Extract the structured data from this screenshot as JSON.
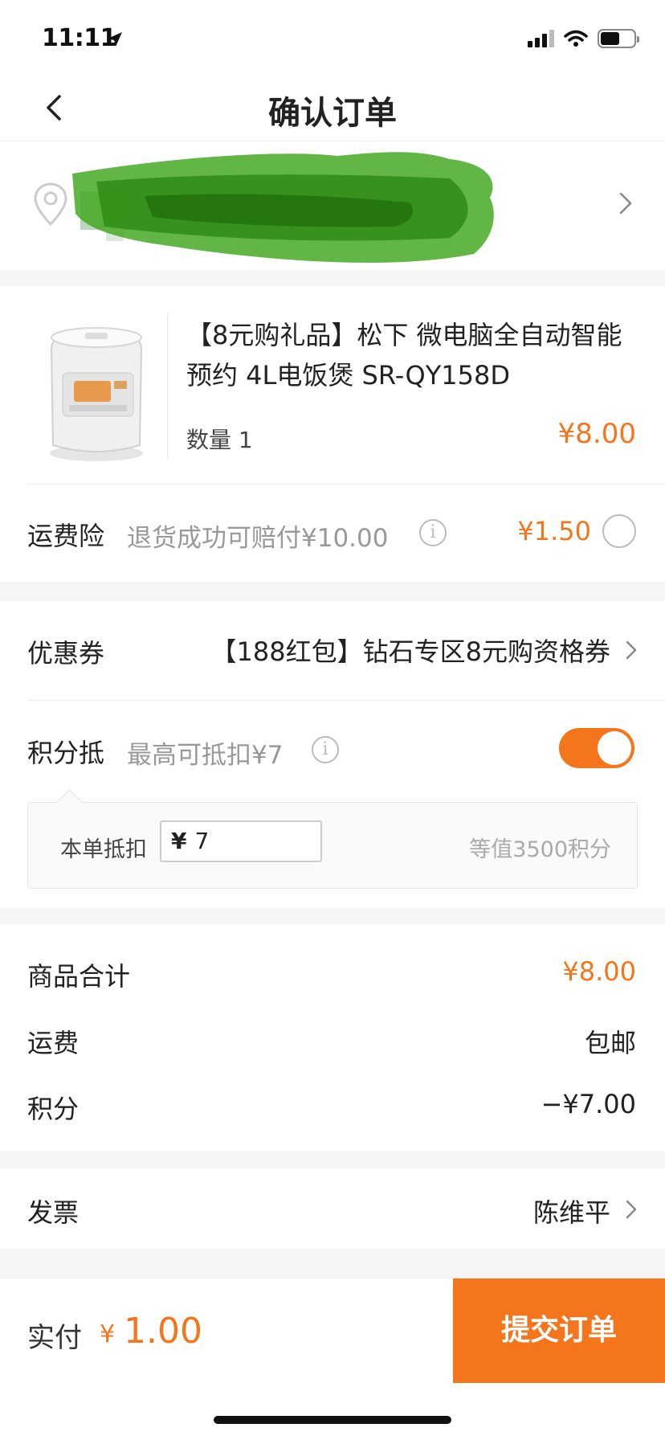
{
  "status_bar": {
    "time": "11:11"
  },
  "nav": {
    "title": "确认订单"
  },
  "product": {
    "title": "【8元购礼品】松下 微电脑全自动智能预约 4L电饭煲 SR-QY158D",
    "quantity": "数量 1",
    "price": "¥8.00"
  },
  "shipping_insurance": {
    "label": "运费险",
    "note": "退货成功可赔付¥10.00",
    "price": "¥1.50",
    "selected": false
  },
  "coupon": {
    "label": "优惠券",
    "value": "【188红包】钻石专区8元购资格券"
  },
  "points": {
    "label": "积分抵",
    "note": "最高可抵扣¥7",
    "enabled": true,
    "deduct_label": "本单抵扣",
    "currency": "¥",
    "deduct_value": "7",
    "equivalent": "等值3500积分"
  },
  "summary": {
    "items": [
      {
        "label": "商品合计",
        "value": "¥8.00"
      },
      {
        "label": "运费",
        "value": "包邮"
      },
      {
        "label": "积分",
        "value": "−¥7.00"
      }
    ]
  },
  "invoice": {
    "label": "发票",
    "value": "陈维平"
  },
  "footer": {
    "pay_label": "实付",
    "currency": "¥",
    "amount": "1.00",
    "submit_label": "提交订单"
  },
  "colors": {
    "accent": "#f5751d",
    "divider": "#f5f5f5"
  }
}
